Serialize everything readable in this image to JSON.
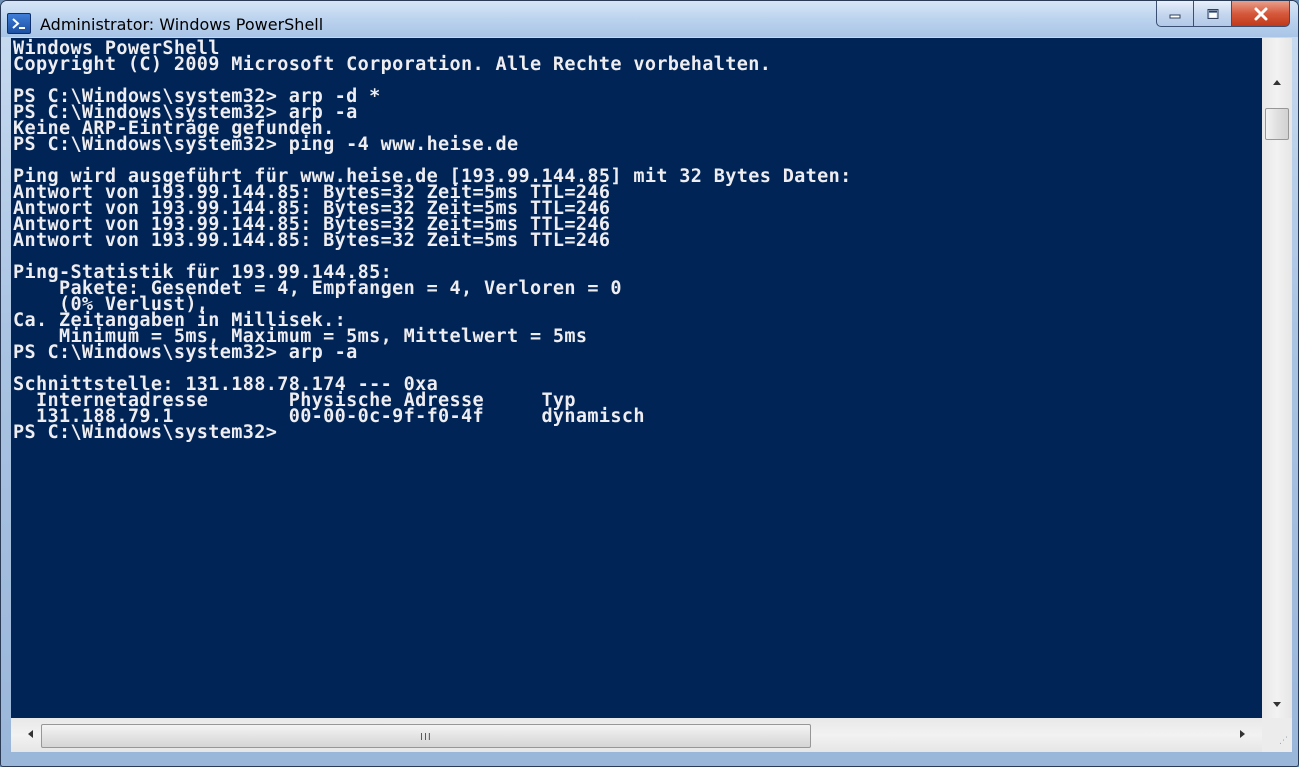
{
  "window": {
    "title": "Administrator: Windows PowerShell",
    "app_icon": "powershell-icon",
    "caption_buttons": {
      "minimize": "minimize-icon",
      "maximize": "maximize-icon",
      "close": "close-icon"
    }
  },
  "console": {
    "background_color": "#012456",
    "text_color": "#eeedf0",
    "lines": [
      "Windows PowerShell",
      "Copyright (C) 2009 Microsoft Corporation. Alle Rechte vorbehalten.",
      "",
      "PS C:\\Windows\\system32> arp -d *",
      "PS C:\\Windows\\system32> arp -a",
      "Keine ARP-Einträge gefunden.",
      "PS C:\\Windows\\system32> ping -4 www.heise.de",
      "",
      "Ping wird ausgeführt für www.heise.de [193.99.144.85] mit 32 Bytes Daten:",
      "Antwort von 193.99.144.85: Bytes=32 Zeit=5ms TTL=246",
      "Antwort von 193.99.144.85: Bytes=32 Zeit=5ms TTL=246",
      "Antwort von 193.99.144.85: Bytes=32 Zeit=5ms TTL=246",
      "Antwort von 193.99.144.85: Bytes=32 Zeit=5ms TTL=246",
      "",
      "Ping-Statistik für 193.99.144.85:",
      "    Pakete: Gesendet = 4, Empfangen = 4, Verloren = 0",
      "    (0% Verlust),",
      "Ca. Zeitangaben in Millisek.:",
      "    Minimum = 5ms, Maximum = 5ms, Mittelwert = 5ms",
      "PS C:\\Windows\\system32> arp -a",
      "",
      "Schnittstelle: 131.188.78.174 --- 0xa",
      "  Internetadresse       Physische Adresse     Typ",
      "  131.188.79.1          00-00-0c-9f-f0-4f     dynamisch",
      "PS C:\\Windows\\system32>"
    ]
  },
  "scrollbars": {
    "horizontal_grip": "III"
  }
}
